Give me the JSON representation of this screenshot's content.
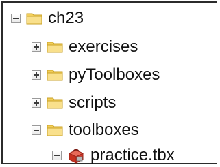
{
  "tree": {
    "root": {
      "label": "ch23",
      "expanded": true,
      "icon": "folder-icon"
    },
    "children": [
      {
        "label": "exercises",
        "expanded": false,
        "icon": "folder-icon"
      },
      {
        "label": "pyToolboxes",
        "expanded": false,
        "icon": "folder-icon"
      },
      {
        "label": "scripts",
        "expanded": false,
        "icon": "folder-icon"
      },
      {
        "label": "toolboxes",
        "expanded": true,
        "icon": "folder-icon"
      }
    ],
    "toolbox": {
      "label": "practice.tbx",
      "expanded": true,
      "icon": "toolbox-icon"
    }
  },
  "colors": {
    "folder_body": "#f6d871",
    "folder_edge": "#c9a227",
    "toolbox_red": "#d63a2c"
  }
}
